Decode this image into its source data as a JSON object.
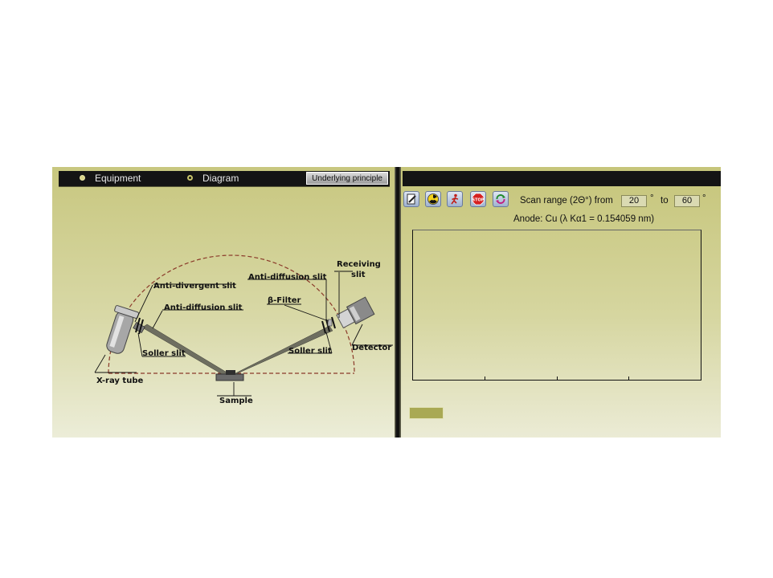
{
  "left": {
    "tabs": [
      {
        "label": "Equipment",
        "selected": true
      },
      {
        "label": "Diagram",
        "selected": false
      }
    ],
    "principle_button": "Underlying principle"
  },
  "diagram": {
    "labels": {
      "receiving_slit": "Receiving slit",
      "anti_divergent": "Anti-divergent slit",
      "anti_diffusion_right": "Anti-diffusion slit",
      "anti_diffusion_left": "Anti-diffusion slit",
      "beta_filter": "β-Filter",
      "soller_left": "Soller slit",
      "soller_right": "Soller slit",
      "detector": "Detector",
      "xray_tube": "X-ray tube",
      "sample": "Sample"
    }
  },
  "right": {
    "tools": [
      {
        "icon": "edit-icon"
      },
      {
        "icon": "radiation-icon"
      },
      {
        "icon": "walk-icon"
      },
      {
        "icon": "stop-icon",
        "text": "STOP"
      },
      {
        "icon": "refresh-icon"
      }
    ],
    "scan_label": "Scan range (2Θ°) from",
    "scan_from": "20",
    "degree_symbol": "°",
    "to_label": "to",
    "scan_to": "60",
    "anode_text": "Anode: Cu (λ Kα1 = 0.154059 nm)"
  },
  "colors": {
    "panel_bg": "#c8c77f",
    "topbar": "#141414",
    "circle_dashed": "#8b3a2a",
    "status_box": "#a9a954"
  }
}
